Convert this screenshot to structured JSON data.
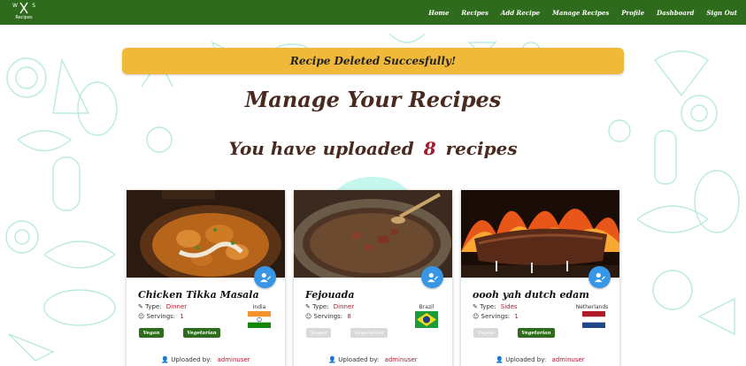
{
  "brand": {
    "letters": [
      "W",
      "S"
    ],
    "sub": "Recipes"
  },
  "nav": [
    "Home",
    "Recipes",
    "Add Recipe",
    "Manage Recipes",
    "Profile",
    "Dashboard",
    "Sign Out"
  ],
  "alert": {
    "text": "Recipe Deleted Succesfully!"
  },
  "page_title": "Manage Your Recipes",
  "count": {
    "prefix": "You have uploaded",
    "number": "8",
    "suffix": "recipes"
  },
  "labels": {
    "type": "Type:",
    "servings": "Servings:",
    "uploaded_by": "Uploaded by:"
  },
  "colors": {
    "nav": "#2f6b1c",
    "alert": "#f0b93a",
    "accent": "#a21b2a",
    "edit_button": "#3896e6"
  },
  "cards": [
    {
      "title": "Chicken Tikka Masala",
      "type": "Dinner",
      "servings": "1",
      "country": "India",
      "vegan": "Vegan",
      "vegetarian": "Vegetarian",
      "vegan_on": true,
      "veg_on": true,
      "uploader": "adminuser"
    },
    {
      "title": "Fejouada",
      "type": "Dinner",
      "servings": "8",
      "country": "Brazil",
      "vegan": "Vegan",
      "vegetarian": "Vegetarian",
      "vegan_on": false,
      "veg_on": false,
      "uploader": "adminuser"
    },
    {
      "title": "oooh yah dutch edam",
      "type": "Sides",
      "servings": "1",
      "country": "Netherlands",
      "vegan": "Vegan",
      "vegetarian": "Vegetarian",
      "vegan_on": false,
      "veg_on": true,
      "uploader": "adminuser"
    }
  ]
}
